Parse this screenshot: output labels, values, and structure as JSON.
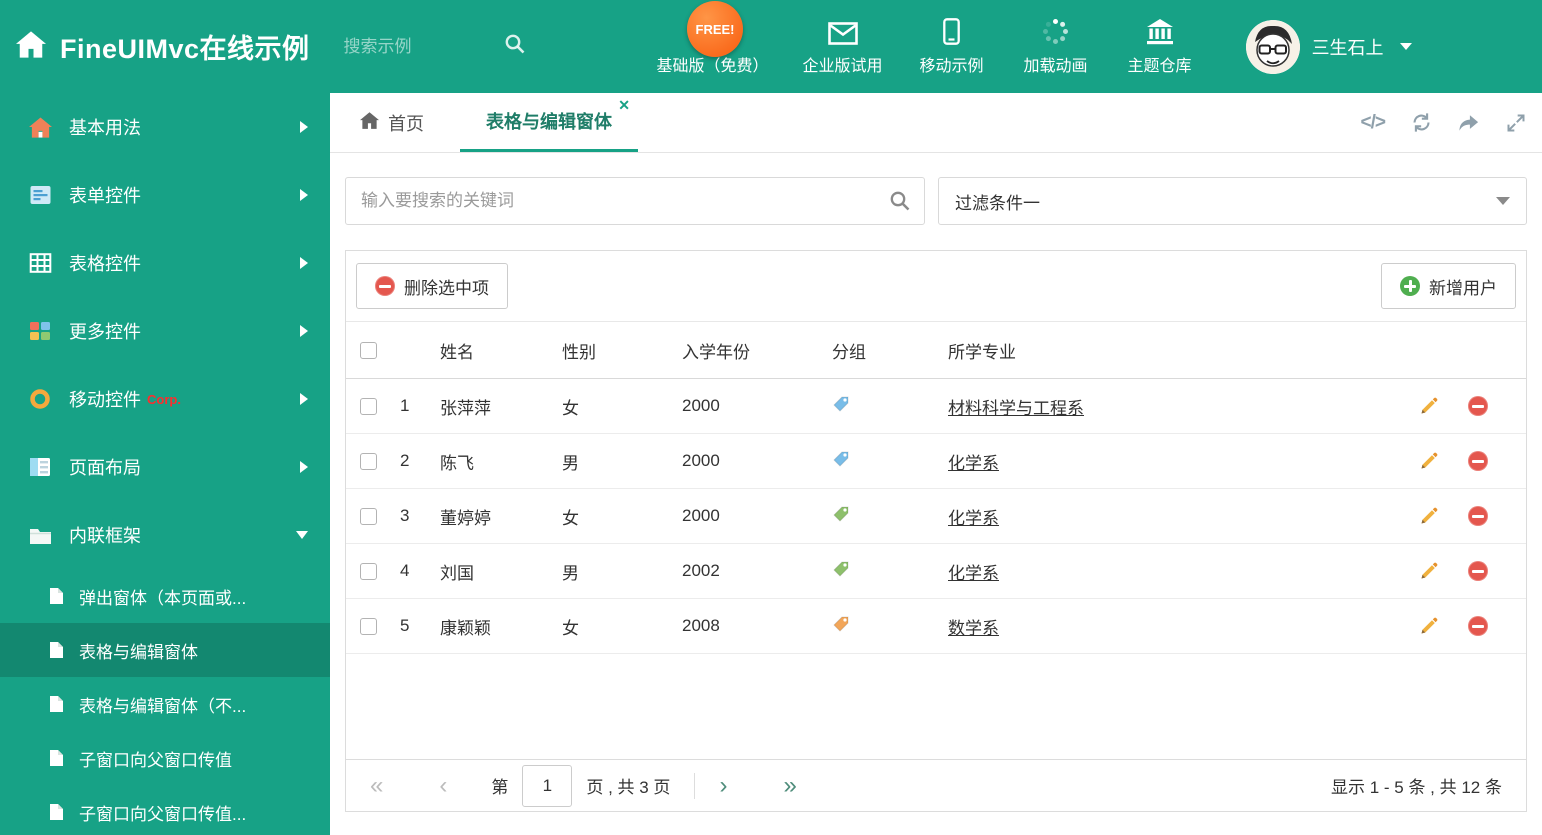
{
  "colors": {
    "teal": "#17a286",
    "active_item_overlay": "#128066",
    "accent_red": "#e4574e",
    "accent_green": "#4fae4f",
    "tag_blue": "#79bde8",
    "tag_green": "#8ec06c",
    "tag_orange": "#f2a65a",
    "free_badge_orange": "#f85c0e"
  },
  "header": {
    "title": "FineUIMvc在线示例",
    "search_placeholder": "搜索示例",
    "free_badge": "FREE!",
    "nav": [
      {
        "label": "基础版（免费）",
        "icon": "download-icon"
      },
      {
        "label": "企业版试用",
        "icon": "envelope-icon"
      },
      {
        "label": "移动示例",
        "icon": "mobile-icon"
      },
      {
        "label": "加载动画",
        "icon": "spinner-icon"
      },
      {
        "label": "主题仓库",
        "icon": "bank-icon"
      }
    ],
    "user_name": "三生石上"
  },
  "sidebar": {
    "items": [
      {
        "label": "基本用法"
      },
      {
        "label": "表单控件"
      },
      {
        "label": "表格控件"
      },
      {
        "label": "更多控件"
      },
      {
        "label": "移动控件",
        "badge": "Corp."
      },
      {
        "label": "页面布局"
      },
      {
        "label": "内联框架",
        "expanded": true
      }
    ],
    "subitems": [
      {
        "label": "弹出窗体（本页面或..."
      },
      {
        "label": "表格与编辑窗体",
        "active": true
      },
      {
        "label": "表格与编辑窗体（不..."
      },
      {
        "label": "子窗口向父窗口传值"
      },
      {
        "label": "子窗口向父窗口传值..."
      }
    ]
  },
  "main": {
    "tabs": [
      {
        "label": "首页"
      },
      {
        "label": "表格与编辑窗体",
        "active": true,
        "closable": true
      }
    ],
    "search": {
      "placeholder": "输入要搜索的关键词"
    },
    "filter": {
      "value": "过滤条件一"
    },
    "toolbar": {
      "delete_label": "删除选中项",
      "add_label": "新增用户"
    },
    "table": {
      "headers": {
        "name": "姓名",
        "gender": "性别",
        "year": "入学年份",
        "group": "分组",
        "major": "所学专业"
      },
      "rows": [
        {
          "num": "1",
          "name": "张萍萍",
          "gender": "女",
          "year": "2000",
          "tag": "blue",
          "major": "材料科学与工程系"
        },
        {
          "num": "2",
          "name": "陈飞",
          "gender": "男",
          "year": "2000",
          "tag": "blue",
          "major": "化学系"
        },
        {
          "num": "3",
          "name": "董婷婷",
          "gender": "女",
          "year": "2000",
          "tag": "green",
          "major": "化学系"
        },
        {
          "num": "4",
          "name": "刘国",
          "gender": "男",
          "year": "2002",
          "tag": "green",
          "major": "化学系"
        },
        {
          "num": "5",
          "name": "康颖颖",
          "gender": "女",
          "year": "2008",
          "tag": "orange",
          "major": "数学系"
        }
      ]
    },
    "pagination": {
      "prefix": "第",
      "page": "1",
      "suffix": "页 , 共 3 页",
      "summary": "显示 1 - 5 条 , 共 12 条"
    }
  }
}
